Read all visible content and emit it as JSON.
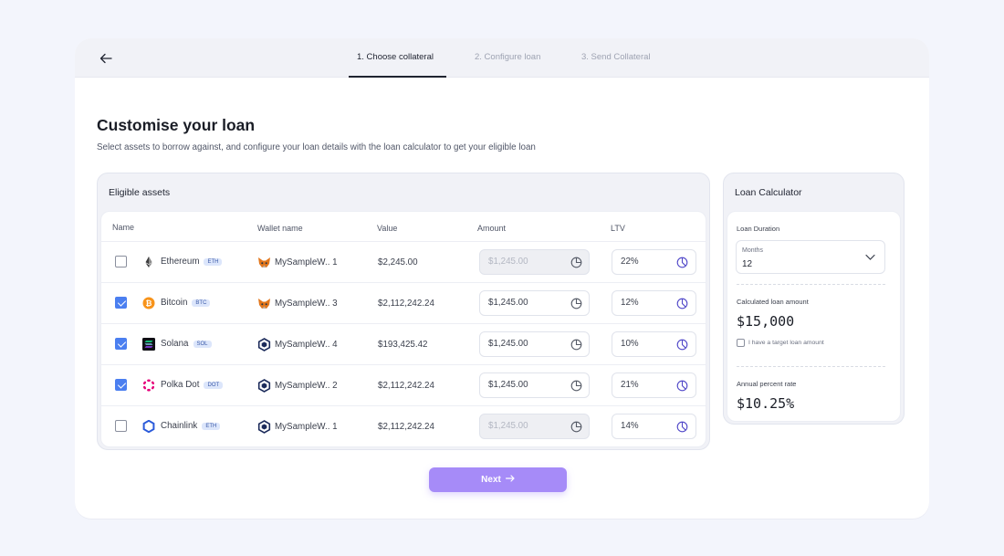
{
  "steps": [
    "1. Choose collateral",
    "2. Configure loan",
    "3. Send Collateral"
  ],
  "page": {
    "title": "Customise your loan",
    "subtitle": "Select assets to borrow against, and configure your loan details with the loan calculator to get your eligible loan"
  },
  "assets": {
    "heading": "Eligible assets",
    "columns": {
      "name": "Name",
      "wallet": "Wallet name",
      "value": "Value",
      "amount": "Amount",
      "ltv": "LTV"
    },
    "rows": [
      {
        "checked": false,
        "name": "Ethereum",
        "tag": "ETH",
        "icon": "ethereum-icon",
        "wallet": "MySampleW.. 1",
        "wallet_icon": "metamask-icon",
        "value": "$2,245.00",
        "amount": "$1,245.00",
        "amount_disabled": true,
        "ltv": "22%"
      },
      {
        "checked": true,
        "name": "Bitcoin",
        "tag": "BTC",
        "icon": "bitcoin-icon",
        "wallet": "MySampleW.. 3",
        "wallet_icon": "metamask-icon",
        "value": "$2,112,242.24",
        "amount": "$1,245.00",
        "amount_disabled": false,
        "ltv": "12%"
      },
      {
        "checked": true,
        "name": "Solana",
        "tag": "SOL",
        "icon": "solana-icon",
        "wallet": "MySampleW.. 4",
        "wallet_icon": "wallet-hex-icon",
        "value": "$193,425.42",
        "amount": "$1,245.00",
        "amount_disabled": false,
        "ltv": "10%"
      },
      {
        "checked": true,
        "name": "Polka Dot",
        "tag": "DOT",
        "icon": "polkadot-icon",
        "wallet": "MySampleW.. 2",
        "wallet_icon": "wallet-hex-icon",
        "value": "$2,112,242.24",
        "amount": "$1,245.00",
        "amount_disabled": false,
        "ltv": "21%"
      },
      {
        "checked": false,
        "name": "Chainlink",
        "tag": "ETH",
        "icon": "chainlink-icon",
        "wallet": "MySampleW.. 1",
        "wallet_icon": "wallet-hex-icon",
        "value": "$2,112,242.24",
        "amount": "$1,245.00",
        "amount_disabled": true,
        "ltv": "14%"
      }
    ]
  },
  "calculator": {
    "heading": "Loan Calculator",
    "duration_label": "Loan Duration",
    "duration_unit": "Months",
    "duration_value": "12",
    "calc_label": "Calculated loan amount",
    "calc_value": "$15,000",
    "target_label": "I have a target loan amount",
    "target_checked": false,
    "apr_label": "Annual  percent rate",
    "apr_value": "$10.25%"
  },
  "next_label": "Next",
  "colors": {
    "accent": "#a68bf8",
    "checkbox": "#4b7ff0",
    "metamask": "#e2761b",
    "bitcoin": "#f7931a",
    "polkadot": "#e6007a",
    "chainlink": "#2a5ada",
    "ltv_icon": "#4f46c8"
  }
}
